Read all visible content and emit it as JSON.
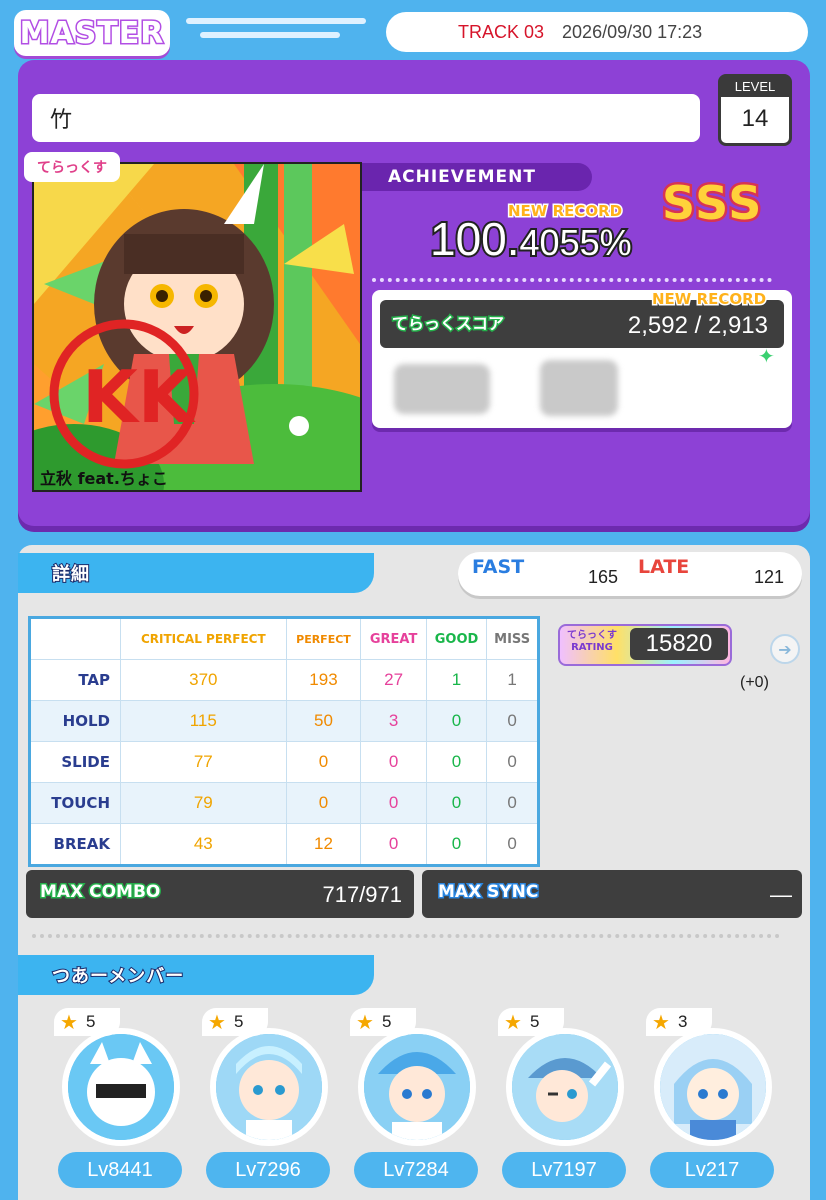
{
  "header": {
    "difficulty": "MASTER",
    "track": "TRACK 03",
    "datetime": "2026/09/30 17:23"
  },
  "song": {
    "title": "竹",
    "level_label": "LEVEL",
    "level": "14",
    "logo": "てらっくす",
    "artist": "立秋 feat.ちょこ"
  },
  "achievement": {
    "label": "ACHIEVEMENT",
    "new_record": "NEW RECORD",
    "int": "100.",
    "dec": "4055%",
    "rank": [
      "S",
      "S",
      "S"
    ]
  },
  "score": {
    "new_record": "NEW RECORD",
    "label": "てらっくスコア",
    "value": "2,592 / 2,913"
  },
  "details": {
    "tab": "詳細",
    "fast_label": "FAST",
    "fast": "165",
    "late_label": "LATE",
    "late": "121",
    "headers": [
      "CRITICAL PERFECT",
      "PERFECT",
      "GREAT",
      "GOOD",
      "MISS"
    ],
    "rows": [
      {
        "name": "TAP",
        "vals": [
          "370",
          "193",
          "27",
          "1",
          "1"
        ]
      },
      {
        "name": "HOLD",
        "vals": [
          "115",
          "50",
          "3",
          "0",
          "0"
        ]
      },
      {
        "name": "SLIDE",
        "vals": [
          "77",
          "0",
          "0",
          "0",
          "0"
        ]
      },
      {
        "name": "TOUCH",
        "vals": [
          "79",
          "0",
          "0",
          "0",
          "0"
        ]
      },
      {
        "name": "BREAK",
        "vals": [
          "43",
          "12",
          "0",
          "0",
          "0"
        ]
      }
    ]
  },
  "rating": {
    "label": "てらっくす RATING",
    "value": "15820",
    "delta": "(+0)"
  },
  "combo": {
    "max_combo_label": "MAX COMBO",
    "max_combo": "717/971",
    "max_sync_label": "MAX SYNC",
    "max_sync": "—"
  },
  "members": {
    "tab": "つあーメンバー",
    "list": [
      {
        "stars": "5",
        "lv": "Lv8441"
      },
      {
        "stars": "5",
        "lv": "Lv7296"
      },
      {
        "stars": "5",
        "lv": "Lv7284"
      },
      {
        "stars": "5",
        "lv": "Lv7197"
      },
      {
        "stars": "3",
        "lv": "Lv217"
      }
    ]
  },
  "colors": {
    "background": "#4fb3ee",
    "panel_purple": "#8d41d6",
    "accent_new_record": "#ffb21b"
  }
}
